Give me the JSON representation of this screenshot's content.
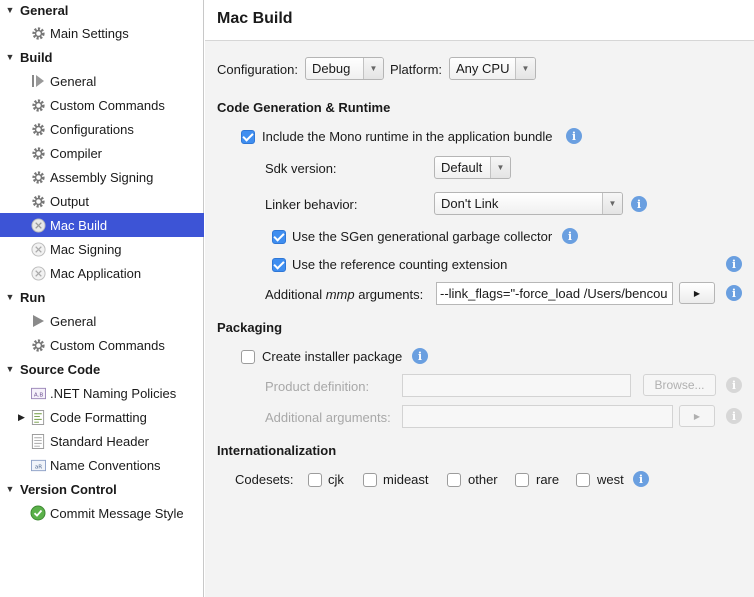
{
  "sidebar": {
    "categories": [
      {
        "label": "General",
        "items": [
          {
            "label": "Main Settings",
            "icon": "gear-icon"
          }
        ]
      },
      {
        "label": "Build",
        "items": [
          {
            "label": "General",
            "icon": "build-arrow-icon"
          },
          {
            "label": "Custom Commands",
            "icon": "gear-icon"
          },
          {
            "label": "Configurations",
            "icon": "gear-icon"
          },
          {
            "label": "Compiler",
            "icon": "gear-icon"
          },
          {
            "label": "Assembly Signing",
            "icon": "gear-icon"
          },
          {
            "label": "Output",
            "icon": "gear-icon"
          },
          {
            "label": "Mac Build",
            "icon": "x-circle-icon",
            "selected": true
          },
          {
            "label": "Mac Signing",
            "icon": "x-circle-icon"
          },
          {
            "label": "Mac Application",
            "icon": "x-circle-icon"
          }
        ]
      },
      {
        "label": "Run",
        "items": [
          {
            "label": "General",
            "icon": "play-icon"
          },
          {
            "label": "Custom Commands",
            "icon": "gear-icon"
          }
        ]
      },
      {
        "label": "Source Code",
        "items": [
          {
            "label": ".NET Naming Policies",
            "icon": "naming-ab-icon",
            "icon_text": "A.B"
          },
          {
            "label": "Code Formatting",
            "icon": "code-document-icon",
            "collapsed": true
          },
          {
            "label": "Standard Header",
            "icon": "document-icon"
          },
          {
            "label": "Name Conventions",
            "icon": "naming-ab-icon",
            "icon_text": "aR"
          }
        ]
      },
      {
        "label": "Version Control",
        "items": [
          {
            "label": "Commit Message Style",
            "icon": "check-circle-icon"
          }
        ]
      }
    ]
  },
  "header": {
    "title": "Mac Build"
  },
  "config": {
    "configuration_label": "Configuration:",
    "configuration_value": "Debug",
    "platform_label": "Platform:",
    "platform_value": "Any CPU"
  },
  "codegen": {
    "title": "Code Generation & Runtime",
    "include_mono": "Include the Mono runtime in the application bundle",
    "sdk_label": "Sdk version:",
    "sdk_value": "Default",
    "linker_label": "Linker behavior:",
    "linker_value": "Don't Link",
    "sgen": "Use the SGen generational garbage collector",
    "refcount": "Use the reference counting extension",
    "mmp_prefix": "Additional ",
    "mmp_italic": "mmp",
    "mmp_suffix": " arguments:",
    "mmp_value": "--link_flags=\"-force_load /Users/bencou",
    "run_glyph": "▶"
  },
  "packaging": {
    "title": "Packaging",
    "create_installer": "Create installer package",
    "product_def_label": "Product definition:",
    "browse_label": "Browse...",
    "additional_args_label": "Additional arguments:",
    "run_glyph": "▶"
  },
  "i18n": {
    "title": "Internationalization",
    "codesets_label": "Codesets:",
    "codesets": [
      "cjk",
      "mideast",
      "other",
      "rare",
      "west"
    ]
  },
  "colors": {
    "selection": "#3d54d6",
    "checkbox": "#3f8ef0",
    "info": "#6a9fe0"
  }
}
